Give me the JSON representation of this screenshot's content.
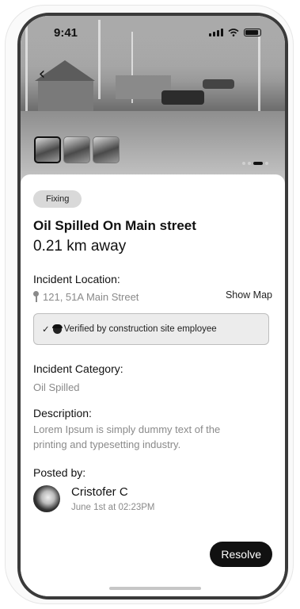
{
  "status_bar": {
    "time": "9:41"
  },
  "gallery": {
    "thumbnail_count": 3,
    "active_dot": 2,
    "dot_count": 4
  },
  "incident": {
    "status_badge": "Fixing",
    "title": "Oil Spilled On Main street",
    "distance": "0.21 km away",
    "location_label": "Incident Location:",
    "location_value": "121, 51A Main Street",
    "show_map_label": "Show Map",
    "verified_text": "Verified by construction site employee",
    "category_label": "Incident Category:",
    "category_value": "Oil Spilled",
    "description_label": "Description:",
    "description_value": "Lorem Ipsum is simply dummy text of the printing and typesetting industry.",
    "posted_by_label": "Posted by:",
    "author_name": "Cristofer C",
    "posted_date": "June 1st at 02:23PM",
    "resolve_label": "Resolve"
  }
}
